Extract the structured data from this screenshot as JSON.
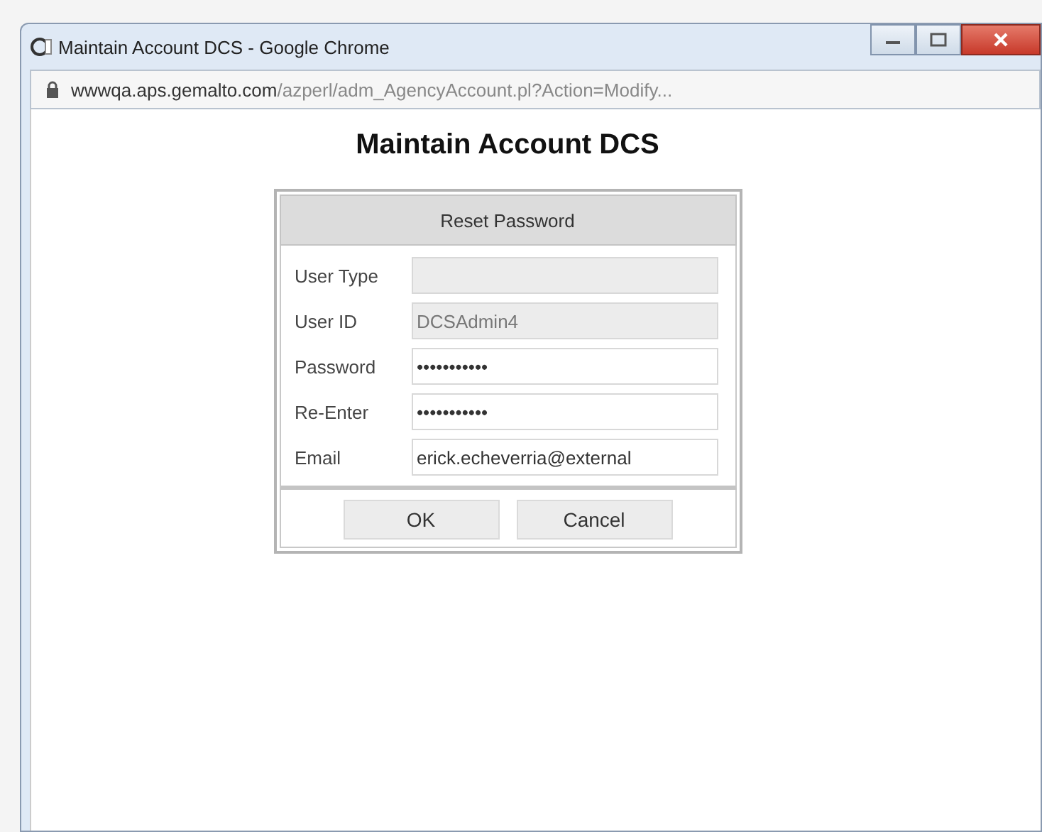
{
  "window": {
    "title": "Maintain Account DCS - Google Chrome"
  },
  "address_bar": {
    "host": "wwwqa.aps.gemalto.com",
    "path": "/azperl/adm_AgencyAccount.pl?Action=Modify..."
  },
  "page": {
    "heading": "Maintain Account DCS"
  },
  "dialog": {
    "title": "Reset Password",
    "fields": [
      {
        "label": "User Type",
        "disabled": true
      },
      {
        "label": "User ID",
        "value": "DCSAdmin4",
        "disabled": true
      },
      {
        "label": "Password",
        "value": "•••••••••••",
        "disabled": false
      },
      {
        "label": "Re-Enter",
        "value": "•••••••••••",
        "disabled": false
      },
      {
        "label": "Email",
        "value": "erick.echeverria@external",
        "disabled": false
      }
    ],
    "buttons": [
      "OK",
      "Cancel"
    ]
  }
}
